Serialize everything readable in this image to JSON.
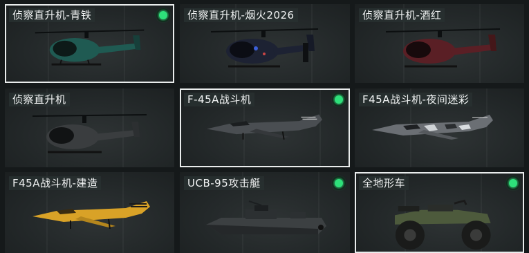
{
  "cards": [
    {
      "label": "侦察直升机-青铁",
      "owned": true,
      "selected": true,
      "icon": "helicopter-icon",
      "color": "#1f5a52"
    },
    {
      "label": "侦察直升机-烟火2026",
      "owned": false,
      "selected": false,
      "icon": "helicopter-icon",
      "color": "#1d2233"
    },
    {
      "label": "侦察直升机-酒红",
      "owned": false,
      "selected": false,
      "icon": "helicopter-icon",
      "color": "#5a1f25"
    },
    {
      "label": "侦察直升机",
      "owned": false,
      "selected": false,
      "icon": "helicopter-icon",
      "color": "#3a3d3f"
    },
    {
      "label": "F-45A战斗机",
      "owned": true,
      "selected": true,
      "icon": "fighter-jet-icon",
      "color": "#4a4e52"
    },
    {
      "label": "F45A战斗机-夜间迷彩",
      "owned": false,
      "selected": false,
      "icon": "fighter-jet-icon",
      "color": "#6b6f74"
    },
    {
      "label": "F45A战斗机-建造",
      "owned": false,
      "selected": false,
      "icon": "fighter-jet-icon",
      "color": "#d9a227"
    },
    {
      "label": "UCB-95攻击艇",
      "owned": true,
      "selected": false,
      "icon": "attack-boat-icon",
      "color": "#3c4042"
    },
    {
      "label": "全地形车",
      "owned": true,
      "selected": true,
      "icon": "atv-icon",
      "color": "#4d5a3c"
    }
  ]
}
